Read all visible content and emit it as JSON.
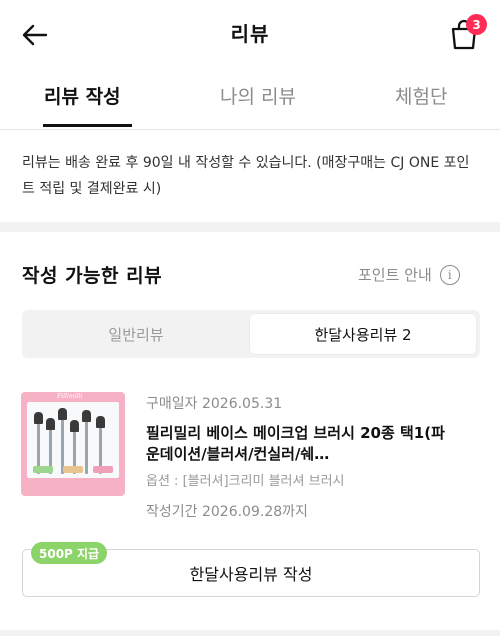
{
  "header": {
    "title": "리뷰",
    "back_icon": "arrow-left-icon",
    "cart_icon": "shopping-bag-icon",
    "cart_count": "3",
    "badge_color": "#ff2c55"
  },
  "tabs": [
    {
      "label": "리뷰 작성",
      "active": true
    },
    {
      "label": "나의 리뷰",
      "active": false
    },
    {
      "label": "체험단",
      "active": false
    }
  ],
  "notice": "리뷰는 배송 완료 후 90일 내 작성할 수 있습니다. (매장구매는 CJ ONE 포인트 적립 및 결제완료 시)",
  "section": {
    "title": "작성 가능한 리뷰",
    "point_guide": "포인트 안내",
    "info_icon": "info-circle-icon"
  },
  "segment": {
    "left": "일반리뷰",
    "right": "한달사용리뷰 2",
    "selected": "right"
  },
  "product": {
    "thumb_label": "Fillimilli",
    "purchase_date": "구매일자 2026.05.31",
    "name": "필리밀리 베이스 메이크업 브러시 20종 택1(파운데이션/블러셔/컨실러/쉐…",
    "option": "옵션 : [블러셔]크리미 블러셔 브러시",
    "period": "작성기간 2026.09.28까지"
  },
  "action": {
    "point_tag": "500P 지급",
    "button": "한달사용리뷰 작성",
    "tag_color": "#8cd46a"
  }
}
